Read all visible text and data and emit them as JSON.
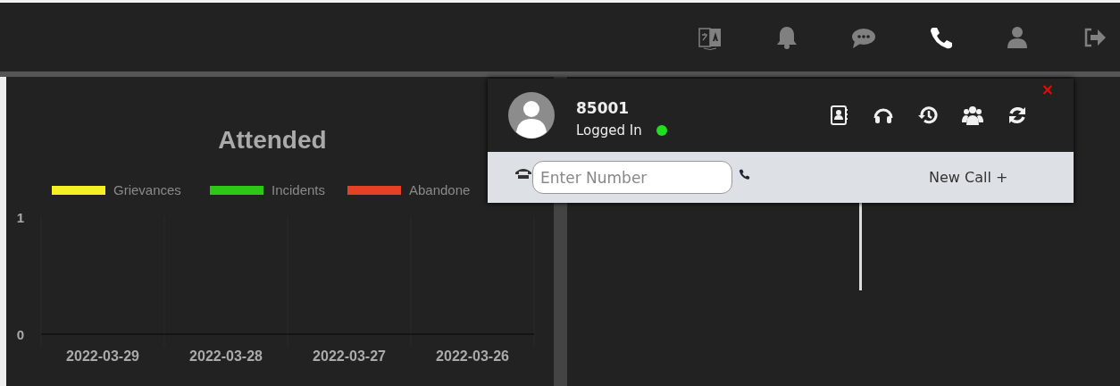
{
  "top_bar": {
    "icons": [
      {
        "kind": "translate",
        "selected": false
      },
      {
        "kind": "bell",
        "selected": false
      },
      {
        "kind": "chat",
        "selected": false
      },
      {
        "kind": "phone",
        "selected": true
      },
      {
        "kind": "user",
        "selected": false
      },
      {
        "kind": "logout",
        "selected": false
      }
    ]
  },
  "chart_panel": {
    "chart_data": {
      "type": "bar",
      "title": "Attended",
      "categories": [
        "2022-03-29",
        "2022-03-28",
        "2022-03-27",
        "2022-03-26"
      ],
      "series": [
        {
          "name": "Grievances",
          "color": "#f5f023",
          "values": [
            0,
            0,
            0,
            0
          ]
        },
        {
          "name": "Incidents",
          "color": "#2ec617",
          "values": [
            0,
            0,
            0,
            0
          ]
        },
        {
          "name": "Abandone",
          "color": "#e54125",
          "values": [
            0,
            0,
            0,
            0
          ]
        }
      ],
      "ylim": [
        0,
        1
      ],
      "yticks": [
        0,
        1
      ]
    }
  },
  "phone_popup": {
    "extension": "85001",
    "status": "Logged In",
    "online": true,
    "actions": [
      {
        "kind": "contacts"
      },
      {
        "kind": "headset"
      },
      {
        "kind": "history"
      },
      {
        "kind": "group"
      },
      {
        "kind": "refresh"
      }
    ],
    "close": "×",
    "dial": {
      "placeholder": "Enter Number"
    },
    "new_call": "New Call +"
  }
}
